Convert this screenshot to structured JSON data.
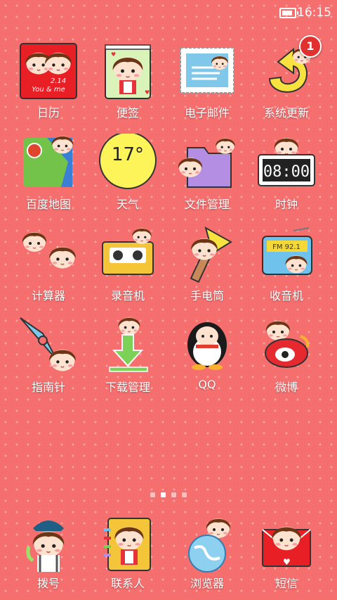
{
  "status_bar": {
    "time": "16:15",
    "battery_level": 0.85,
    "battery_icon": "battery-icon"
  },
  "apps": [
    {
      "id": "calendar",
      "label": "日历",
      "icon": "calendar-icon",
      "icon_text_line1": "2.14",
      "icon_text_line2": "You & me"
    },
    {
      "id": "notes",
      "label": "便签",
      "icon": "notes-icon"
    },
    {
      "id": "email",
      "label": "电子邮件",
      "icon": "email-icon"
    },
    {
      "id": "system-update",
      "label": "系统更新",
      "icon": "update-icon",
      "badge": "1"
    },
    {
      "id": "baidu-map",
      "label": "百度地图",
      "icon": "map-icon"
    },
    {
      "id": "weather",
      "label": "天气",
      "icon": "weather-icon",
      "temperature": "17°"
    },
    {
      "id": "file-manager",
      "label": "文件管理",
      "icon": "folder-icon"
    },
    {
      "id": "clock",
      "label": "时钟",
      "icon": "clock-icon",
      "icon_time": "08:00"
    },
    {
      "id": "calculator",
      "label": "计算器",
      "icon": "calculator-icon"
    },
    {
      "id": "recorder",
      "label": "录音机",
      "icon": "cassette-icon"
    },
    {
      "id": "flashlight",
      "label": "手电筒",
      "icon": "flashlight-icon"
    },
    {
      "id": "radio",
      "label": "收音机",
      "icon": "radio-icon",
      "frequency": "FM 92.1"
    },
    {
      "id": "compass",
      "label": "指南针",
      "icon": "compass-icon"
    },
    {
      "id": "download-manager",
      "label": "下载管理",
      "icon": "download-icon"
    },
    {
      "id": "qq",
      "label": "QQ",
      "icon": "qq-penguin-icon"
    },
    {
      "id": "weibo",
      "label": "微博",
      "icon": "weibo-icon"
    }
  ],
  "page_indicator": {
    "pages": 4,
    "current": 2
  },
  "dock": [
    {
      "id": "dialer",
      "label": "拨号",
      "icon": "phone-icon"
    },
    {
      "id": "contacts",
      "label": "联系人",
      "icon": "contacts-icon"
    },
    {
      "id": "browser",
      "label": "浏览器",
      "icon": "globe-icon"
    },
    {
      "id": "messages",
      "label": "短信",
      "icon": "envelope-icon"
    }
  ]
}
